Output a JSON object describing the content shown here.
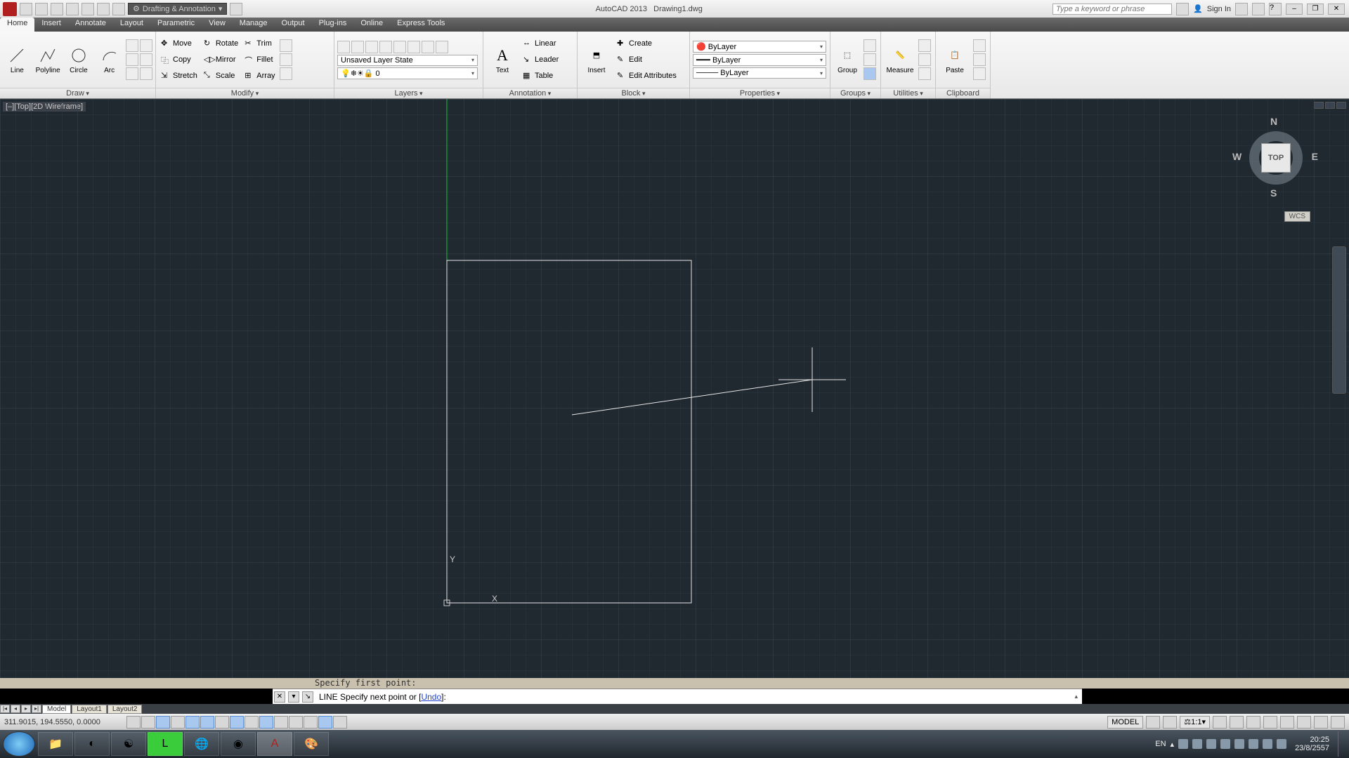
{
  "title": {
    "app": "AutoCAD 2013",
    "file": "Drawing1.dwg"
  },
  "qat_workspace": "Drafting & Annotation",
  "search": {
    "placeholder": "Type a keyword or phrase"
  },
  "signin": "Sign In",
  "tabs": [
    "Home",
    "Insert",
    "Annotate",
    "Layout",
    "Parametric",
    "View",
    "Manage",
    "Output",
    "Plug-ins",
    "Online",
    "Express Tools"
  ],
  "active_tab": "Home",
  "ribbon": {
    "draw": {
      "label": "Draw",
      "line": "Line",
      "polyline": "Polyline",
      "circle": "Circle",
      "arc": "Arc"
    },
    "modify": {
      "label": "Modify",
      "move": "Move",
      "rotate": "Rotate",
      "trim": "Trim",
      "copy": "Copy",
      "mirror": "Mirror",
      "fillet": "Fillet",
      "stretch": "Stretch",
      "scale": "Scale",
      "array": "Array"
    },
    "layers": {
      "label": "Layers",
      "state": "Unsaved Layer State",
      "current": "0"
    },
    "annotation": {
      "label": "Annotation",
      "text": "Text",
      "linear": "Linear",
      "leader": "Leader",
      "table": "Table"
    },
    "block": {
      "label": "Block",
      "insert": "Insert",
      "create": "Create",
      "edit": "Edit",
      "editattr": "Edit Attributes"
    },
    "properties": {
      "label": "Properties",
      "bylayer": "ByLayer"
    },
    "groups": {
      "label": "Groups",
      "group": "Group"
    },
    "utilities": {
      "label": "Utilities",
      "measure": "Measure"
    },
    "clipboard": {
      "label": "Clipboard",
      "paste": "Paste"
    }
  },
  "view_label": "[–][Top][2D Wireframe]",
  "viewcube": {
    "top": "TOP",
    "n": "N",
    "s": "S",
    "e": "E",
    "w": "W"
  },
  "wcs": "WCS",
  "cmd_history": "Specify first point:",
  "cmd_prompt": {
    "cmd": "LINE",
    "text": "Specify next point or [",
    "opt": "Undo",
    "tail": "]:"
  },
  "layouts": {
    "nav": [
      "|◂",
      "◂",
      "▸",
      "▸|"
    ],
    "tabs": [
      "Model",
      "Layout1",
      "Layout2"
    ],
    "active": "Model"
  },
  "status": {
    "coords": "311.9015, 194.5550, 0.0000",
    "model": "MODEL",
    "scale": "1:1",
    "lang": "EN"
  },
  "clock": {
    "time": "20:25",
    "date": "23/8/2557"
  }
}
